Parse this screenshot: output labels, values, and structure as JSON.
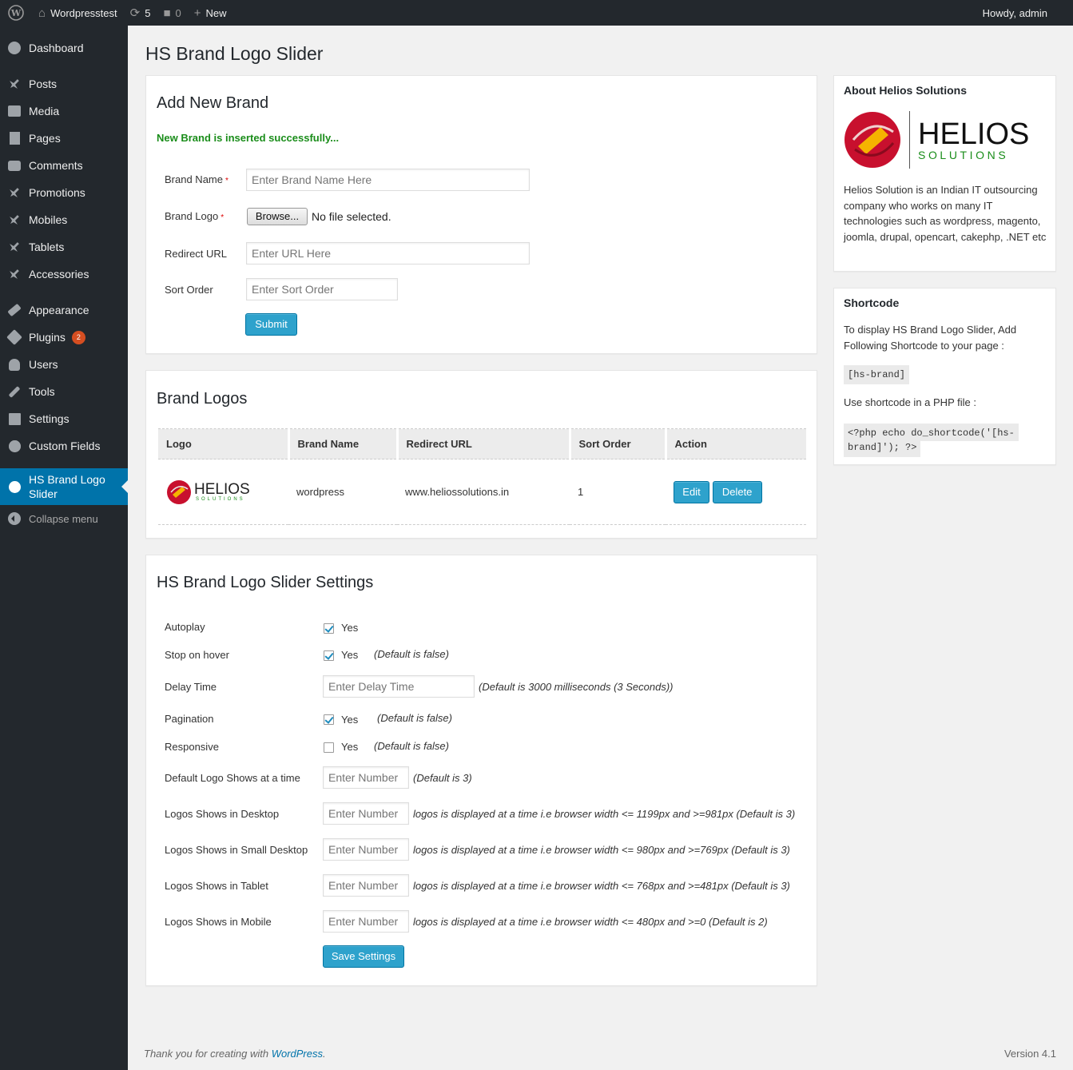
{
  "adminbar": {
    "site_name": "Wordpresstest",
    "updates_count": "5",
    "comments_count": "0",
    "new_label": "New",
    "howdy": "Howdy, admin"
  },
  "sidebar": {
    "items": [
      {
        "label": "Dashboard",
        "icon": "dashboard-icon"
      },
      {
        "label": "Posts",
        "icon": "pin-icon"
      },
      {
        "label": "Media",
        "icon": "media-icon"
      },
      {
        "label": "Pages",
        "icon": "pages-icon"
      },
      {
        "label": "Comments",
        "icon": "comment-icon"
      },
      {
        "label": "Promotions",
        "icon": "pin-icon"
      },
      {
        "label": "Mobiles",
        "icon": "pin-icon"
      },
      {
        "label": "Tablets",
        "icon": "pin-icon"
      },
      {
        "label": "Accessories",
        "icon": "pin-icon"
      },
      {
        "label": "Appearance",
        "icon": "brush-icon"
      },
      {
        "label": "Plugins",
        "icon": "plugin-icon",
        "badge": "2"
      },
      {
        "label": "Users",
        "icon": "user-icon"
      },
      {
        "label": "Tools",
        "icon": "wrench-icon"
      },
      {
        "label": "Settings",
        "icon": "settings-icon"
      },
      {
        "label": "Custom Fields",
        "icon": "gear-icon"
      },
      {
        "label": "HS Brand Logo Slider",
        "icon": "gear-icon"
      }
    ],
    "collapse": "Collapse menu"
  },
  "page": {
    "title": "HS Brand Logo Slider"
  },
  "add_brand": {
    "heading": "Add New Brand",
    "notice": "New Brand is inserted successfully...",
    "brand_name_label": "Brand Name",
    "brand_name_placeholder": "Enter Brand Name Here",
    "brand_logo_label": "Brand Logo",
    "browse_label": "Browse...",
    "no_file": "No file selected.",
    "redirect_label": "Redirect URL",
    "redirect_placeholder": "Enter URL Here",
    "sort_label": "Sort Order",
    "sort_placeholder": "Enter Sort Order",
    "required_mark": "*",
    "submit": "Submit"
  },
  "brand_logos": {
    "heading": "Brand Logos",
    "columns": [
      "Logo",
      "Brand Name",
      "Redirect URL",
      "Sort Order",
      "Action"
    ],
    "rows": [
      {
        "logo_text": "HELIOS",
        "logo_sub": "SOLUTIONS",
        "brand_name": "wordpress",
        "redirect_url": "www.heliossolutions.in",
        "sort_order": "1",
        "edit": "Edit",
        "delete": "Delete"
      }
    ]
  },
  "settings": {
    "heading": "HS Brand Logo Slider Settings",
    "autoplay_label": "Autoplay",
    "autoplay_checked": true,
    "stop_hover_label": "Stop on hover",
    "stop_hover_checked": true,
    "stop_hover_hint": "(Default is false)",
    "delay_label": "Delay Time",
    "delay_placeholder": "Enter Delay Time",
    "delay_hint": "(Default is 3000 milliseconds (3 Seconds))",
    "pagination_label": "Pagination",
    "pagination_checked": true,
    "pagination_hint": "(Default is false)",
    "responsive_label": "Responsive",
    "responsive_checked": false,
    "responsive_hint": "(Default is false)",
    "yes": "Yes",
    "default_logo_label": "Default Logo Shows at a time",
    "number_placeholder": "Enter Number",
    "default_logo_hint": "(Default is 3)",
    "desktop_label": "Logos Shows in Desktop",
    "desktop_hint": "logos is displayed at a time i.e browser width <= 1199px and >=981px (Default is 3)",
    "small_desktop_label": "Logos Shows in Small Desktop",
    "small_desktop_hint": "logos is displayed at a time i.e browser width <= 980px and >=769px (Default is 3)",
    "tablet_label": "Logos Shows in Tablet",
    "tablet_hint": "logos is displayed at a time i.e browser width <= 768px and >=481px (Default is 3)",
    "mobile_label": "Logos Shows in Mobile",
    "mobile_hint": "logos is displayed at a time i.e browser width <= 480px and >=0 (Default is 2)",
    "save": "Save Settings"
  },
  "about": {
    "heading": "About Helios Solutions",
    "logo_text": "HELIOS",
    "logo_sub": "SOLUTIONS",
    "text": "Helios Solution is an Indian IT outsourcing company who works on many IT technologies such as wordpress, magento, joomla, drupal, opencart, cakephp, .NET etc"
  },
  "shortcode": {
    "heading": "Shortcode",
    "intro": "To display HS Brand Logo Slider, Add Following Shortcode to your page :",
    "code": "[hs-brand]",
    "php_intro": "Use shortcode in a PHP file :",
    "php_code_1": "<?php echo do_shortcode('[hs-",
    "php_code_2": "brand]'); ?>"
  },
  "footer": {
    "thanks": "Thank you for creating with ",
    "link": "WordPress",
    "period": ".",
    "version": "Version 4.1"
  },
  "colors": {
    "accent": "#0073aa",
    "button": "#2ea2cc",
    "success": "#1a8d1a",
    "sidebar": "#23282d",
    "logo_red": "#c8102e",
    "logo_yellow": "#f5b400"
  }
}
